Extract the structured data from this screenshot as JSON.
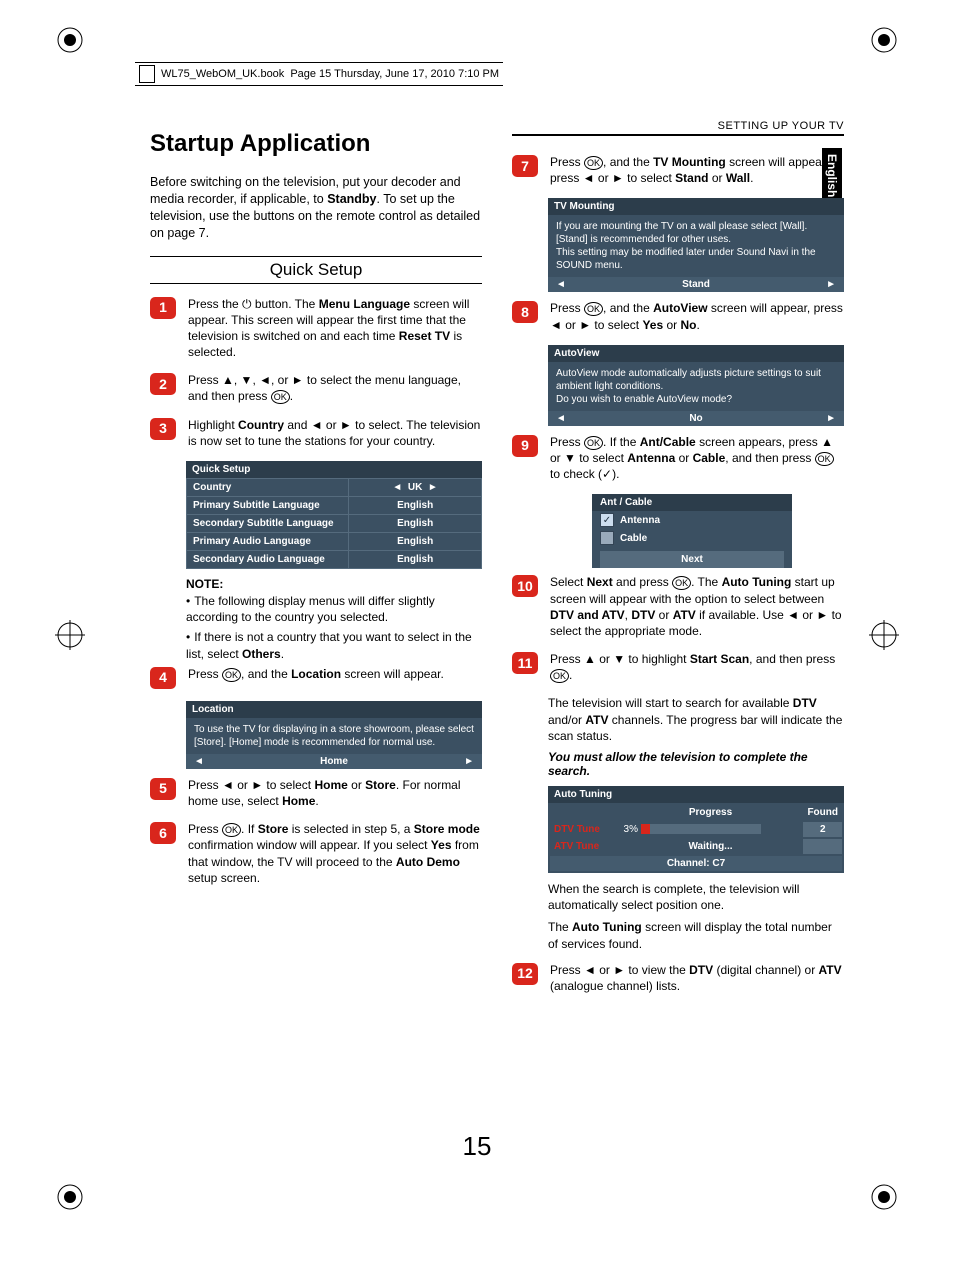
{
  "header": {
    "filename": "WL75_WebOM_UK.book",
    "meta": "Page 15  Thursday, June 17, 2010  7:10 PM"
  },
  "section_header": "SETTING UP YOUR TV",
  "lang_tab": "English",
  "title": "Startup Application",
  "intro_a": "Before switching on the television, put your decoder and media recorder, if applicable, to ",
  "intro_b": "Standby",
  "intro_c": ". To set up the television, use the buttons on the remote control as detailed on page 7.",
  "subhead": "Quick Setup",
  "step1": {
    "a": "Press the ",
    "b": " button. The ",
    "c": "Menu Language",
    "d": " screen will appear. This screen will appear the first time that the television is switched on and each time ",
    "e": "Reset TV",
    "f": " is selected."
  },
  "step2": {
    "a": "Press ",
    "b": " to select the menu language, and then press "
  },
  "step3": {
    "a": "Highlight ",
    "b": "Country",
    "c": " and ◄ or ► to select. The television is now set to tune the stations for your country."
  },
  "qs_table": {
    "title": "Quick Setup",
    "rows": [
      {
        "label": "Country",
        "val": "UK",
        "arrows": true
      },
      {
        "label": "Primary Subtitle Language",
        "val": "English"
      },
      {
        "label": "Secondary Subtitle Language",
        "val": "English"
      },
      {
        "label": "Primary Audio Language",
        "val": "English"
      },
      {
        "label": "Secondary Audio Language",
        "val": "English"
      }
    ]
  },
  "note_head": "NOTE:",
  "note1": "The following display menus will differ slightly according to the country you selected.",
  "note2a": "If there is not a country that you want to select in the list, select ",
  "note2b": "Others",
  "step4": {
    "a": "Press ",
    "b": ", and the ",
    "c": "Location",
    "d": " screen will appear."
  },
  "loc_box": {
    "title": "Location",
    "body": "To use the TV for displaying in a store showroom, please select [Store].  [Home] mode is recommended for normal use.",
    "sel": "Home"
  },
  "step5": {
    "a": "Press ◄ or ► to select ",
    "b": "Home",
    "c": " or ",
    "d": "Store",
    "e": ". For normal home use, select ",
    "f": "Home",
    "g": "."
  },
  "step6": {
    "a": "Press ",
    "b": ". If ",
    "c": "Store",
    "d": " is selected in step 5, a ",
    "e": "Store mode",
    "f": " confirmation window will appear. If you select ",
    "g": "Yes",
    "h": " from that window, the TV will proceed to the ",
    "i": "Auto Demo",
    "j": " setup screen."
  },
  "step7": {
    "a": "Press ",
    "b": ", and the ",
    "c": "TV Mounting",
    "d": " screen will appear, press ◄ or ► to select ",
    "e": "Stand",
    "f": " or ",
    "g": "Wall",
    "h": "."
  },
  "tvm_box": {
    "title": "TV Mounting",
    "body": "If you are mounting the TV on a wall please select [Wall]. [Stand] is recommended for other uses.\nThis setting may be modified later under Sound Navi in the SOUND menu.",
    "sel": "Stand"
  },
  "step8": {
    "a": "Press ",
    "b": ", and the ",
    "c": "AutoView",
    "d": " screen will appear, press ◄ or ► to select ",
    "e": "Yes",
    "f": " or ",
    "g": "No",
    "h": "."
  },
  "av_box": {
    "title": "AutoView",
    "body": "AutoView mode automatically adjusts picture settings to suit ambient light conditions.\nDo you wish to enable AutoView mode?",
    "sel": "No"
  },
  "step9": {
    "a": "Press ",
    "b": ". If the ",
    "c": "Ant/Cable",
    "d": " screen appears, press ▲ or ▼ to select ",
    "e": "Antenna",
    "f": " or ",
    "g": "Cable",
    "h": ", and then press ",
    "i": " to check (✓)."
  },
  "ant_box": {
    "title": "Ant / Cable",
    "opt1": "Antenna",
    "opt2": "Cable",
    "next": "Next"
  },
  "step10": {
    "a": "Select ",
    "b": "Next",
    "c": " and press ",
    "d": ". The ",
    "e": "Auto Tuning",
    "f": " start up screen will appear with the option to select between ",
    "g": "DTV and ATV",
    "h": ", ",
    "i": "DTV",
    "j": " or ",
    "k": "ATV",
    "l": " if available. Use ◄ or ► to select the appropriate mode."
  },
  "step11": {
    "a": "Press ▲ or ▼ to highlight ",
    "b": "Start Scan",
    "c": ", and then press "
  },
  "post11a": "The television will start to search for available ",
  "post11b": "DTV",
  "post11c": " and/or ",
  "post11d": "ATV",
  "post11e": " channels. The progress bar will indicate the scan status.",
  "must_allow": "You must allow the television to complete the search.",
  "at_box": {
    "title": "Auto Tuning",
    "progress": "Progress",
    "found": "Found",
    "dtv": "DTV Tune",
    "dtv_pct": "3%",
    "dtv_found": "2",
    "atv": "ATV Tune",
    "atv_stat": "Waiting...",
    "channel": "Channel: C7"
  },
  "post_at1": "When the search is complete, the television will automatically select position one.",
  "post_at2a": "The ",
  "post_at2b": "Auto Tuning",
  "post_at2c": " screen will display the total number of services found.",
  "step12": {
    "a": "Press ◄ or ► to view the ",
    "b": "DTV",
    "c": " (digital channel) or ",
    "d": "ATV",
    "e": " (analogue channel) lists."
  },
  "pagenum": "15"
}
